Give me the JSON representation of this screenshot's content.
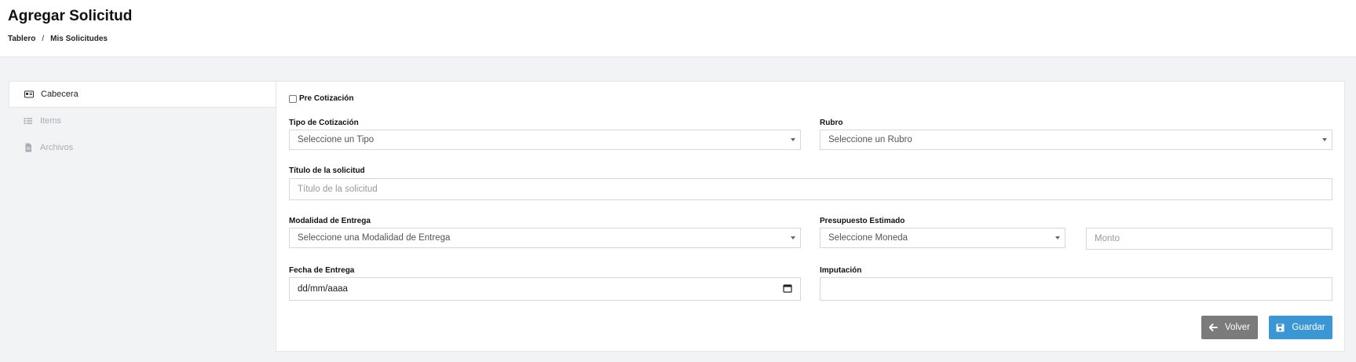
{
  "header": {
    "title": "Agregar Solicitud",
    "breadcrumb": [
      "Tablero",
      "/",
      "Mis Solicitudes"
    ]
  },
  "sidebar": {
    "items": [
      {
        "label": "Cabecera",
        "icon": "id-card-icon",
        "active": true
      },
      {
        "label": "Items",
        "icon": "list-icon",
        "active": false
      },
      {
        "label": "Archivos",
        "icon": "file-icon",
        "active": false
      }
    ]
  },
  "form": {
    "pre_cotizacion": {
      "label": "Pre Cotización",
      "checked": false
    },
    "tipo_cotizacion": {
      "label": "Tipo de Cotización",
      "value": "Seleccione un Tipo"
    },
    "rubro": {
      "label": "Rubro",
      "value": "Seleccione un Rubro"
    },
    "titulo": {
      "label": "Título de la solicitud",
      "value": "",
      "placeholder": "Título de la solicitud"
    },
    "modalidad": {
      "label": "Modalidad de Entrega",
      "value": "Seleccione una Modalidad de Entrega"
    },
    "presupuesto": {
      "label": "Presupuesto Estimado",
      "moneda": "Seleccione Moneda",
      "monto_placeholder": "Monto",
      "monto_value": ""
    },
    "fecha": {
      "label": "Fecha de Entrega",
      "value": "dd/mm/aaaa"
    },
    "imputacion": {
      "label": "Imputación",
      "value": ""
    }
  },
  "actions": {
    "back_label": "Volver",
    "save_label": "Guardar"
  },
  "colors": {
    "accent": "#3a97d4",
    "secondary": "#7b7b7b",
    "background": "#f2f3f5"
  }
}
